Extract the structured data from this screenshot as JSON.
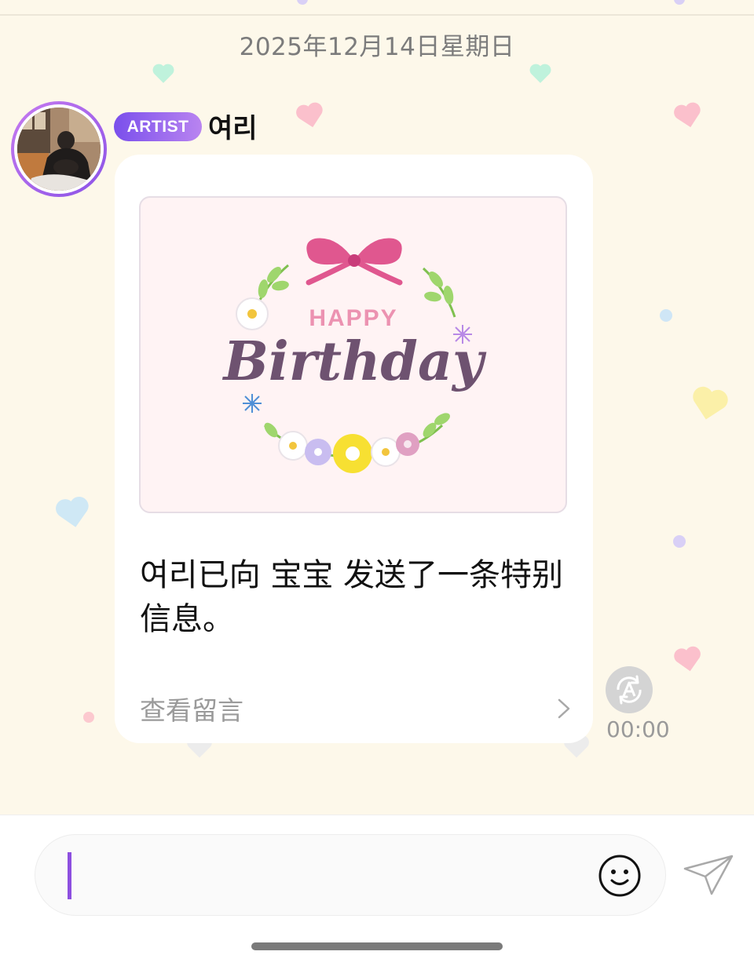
{
  "chat": {
    "date_divider": "2025年12月14日星期日"
  },
  "message": {
    "badge": "ARTIST",
    "sender": "여리",
    "card": {
      "heading_small": "HAPPY",
      "heading_large": "Birthday"
    },
    "text": "여리已向 宝宝 发送了一条特别信息。",
    "link_label": "查看留言",
    "time": "00:00"
  },
  "icons": {
    "translate": "translate-a-icon",
    "chevron": "chevron-right-icon",
    "emoji": "smiley-icon",
    "send": "paper-plane-icon"
  },
  "colors": {
    "accent": "#8d4fe0",
    "background": "#fdf8ea"
  }
}
